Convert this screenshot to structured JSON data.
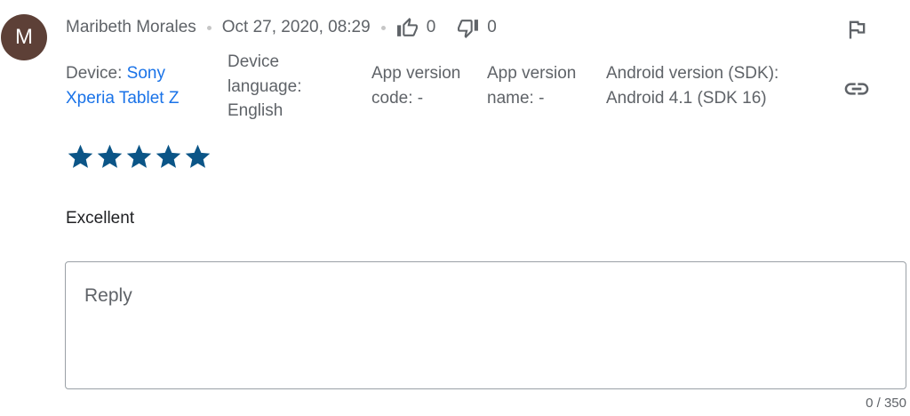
{
  "review": {
    "avatar_initial": "M",
    "avatar_color": "#5d4037",
    "author": "Maribeth Morales",
    "timestamp": "Oct 27, 2020, 08:29",
    "thumbs_up_count": "0",
    "thumbs_down_count": "0",
    "rating": 5,
    "rating_max": 5,
    "star_color": "#0b5587",
    "text": "Excellent"
  },
  "device_info": {
    "device_label": "Device:",
    "device_value": "Sony Xperia Tablet Z",
    "language_label": "Device language:",
    "language_value": "English",
    "version_code_label": "App version code:",
    "version_code_value": "-",
    "version_name_label": "App version name:",
    "version_name_value": "-",
    "android_label": "Android version (SDK):",
    "android_value": "Android 4.1 (SDK 16)"
  },
  "icons": {
    "thumbs_up": "thumbs-up-icon",
    "thumbs_down": "thumbs-down-icon",
    "flag": "flag-icon",
    "link": "link-icon",
    "star": "star-icon"
  },
  "reply": {
    "placeholder": "Reply",
    "value": "",
    "counter": "0 / 350"
  }
}
